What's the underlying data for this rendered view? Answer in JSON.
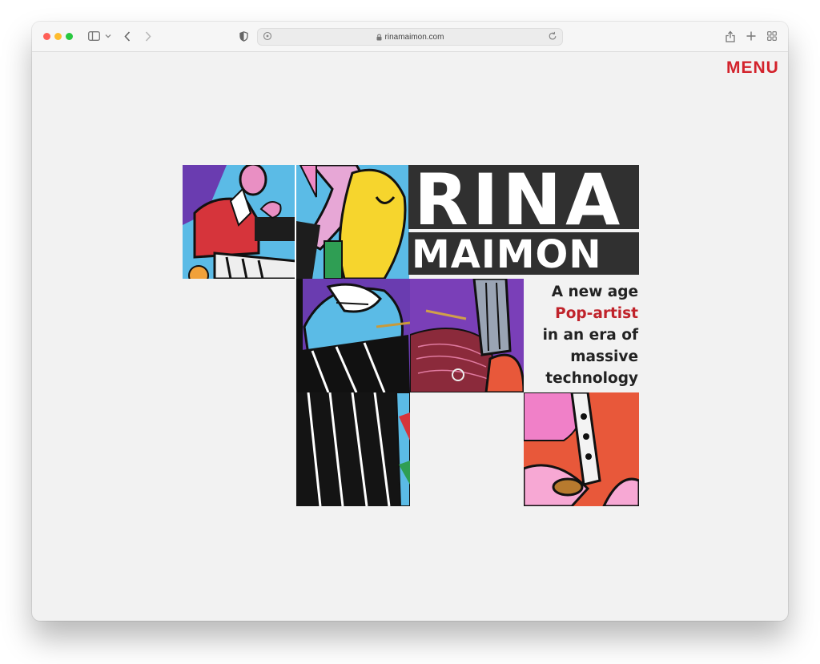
{
  "browser": {
    "url": "rinamaimon.com",
    "icons": [
      "sidebar-icon",
      "chevron-down-icon",
      "back-icon",
      "forward-icon",
      "privacy-shield-icon",
      "page-settings-icon",
      "lock-icon",
      "reload-icon",
      "share-icon",
      "new-tab-icon",
      "tab-overview-icon"
    ]
  },
  "page": {
    "menu_label": "MENU",
    "title_line1": "RINA",
    "title_line2": "MAIMON",
    "tagline": {
      "line1": "A new age",
      "line2": "Pop-artist",
      "line3": "in an era of",
      "line4": "massive",
      "line5": "technology"
    }
  },
  "colors": {
    "accent": "#d3232c",
    "title_bg": "#303030",
    "page_bg": "#f2f2f2"
  }
}
